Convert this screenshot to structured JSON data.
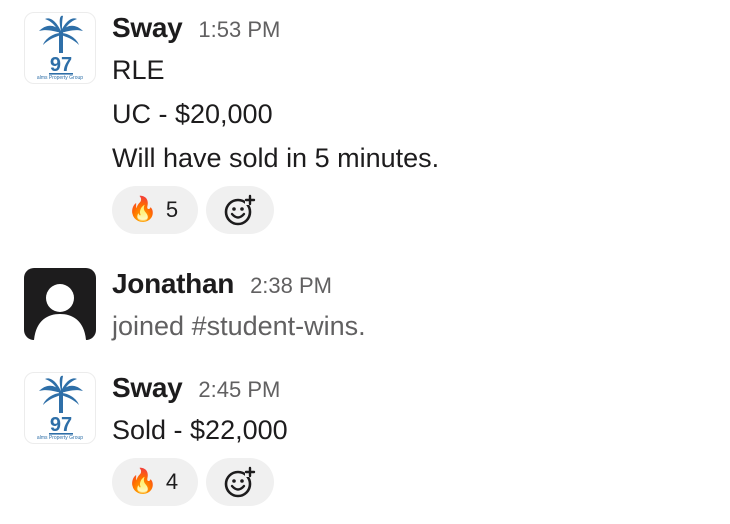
{
  "messages": [
    {
      "author": "Sway",
      "time": "1:53 PM",
      "avatar": {
        "type": "logo",
        "logo_number": "97",
        "logo_caption": "alms Property Group",
        "brand_color": "#2e6fa8"
      },
      "lines": [
        "RLE",
        "UC - $20,000",
        "Will have sold in 5 minutes."
      ],
      "reaction": {
        "emoji": "fire-icon",
        "glyph": "🔥",
        "count": "5"
      },
      "add_reaction_icon": "add-emoji-icon"
    },
    {
      "author": "Jonathan",
      "time": "2:38 PM",
      "avatar": {
        "type": "default"
      },
      "lines": [
        "joined #student-wins."
      ]
    },
    {
      "author": "Sway",
      "time": "2:45 PM",
      "avatar": {
        "type": "logo",
        "logo_number": "97",
        "logo_caption": "alms Property Group",
        "brand_color": "#2e6fa8"
      },
      "lines": [
        "Sold - $22,000"
      ],
      "reaction": {
        "emoji": "fire-icon",
        "glyph": "🔥",
        "count": "4"
      },
      "add_reaction_icon": "add-emoji-icon"
    }
  ]
}
